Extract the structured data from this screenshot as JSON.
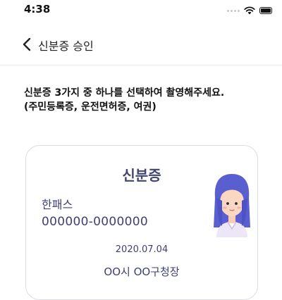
{
  "status_bar": {
    "time": "4:38"
  },
  "nav": {
    "title": "신분증 승인"
  },
  "instruction": {
    "line1": "신분증 3가지 중 하나를 선택하여 촬영해주세요.",
    "line2": "(주민등록증, 운전면허증, 여권)"
  },
  "id_card": {
    "title": "신분증",
    "name": "한패스",
    "number": "000000-0000000",
    "date": "2020.07.04",
    "issuer": "OO시 OO구청장"
  }
}
